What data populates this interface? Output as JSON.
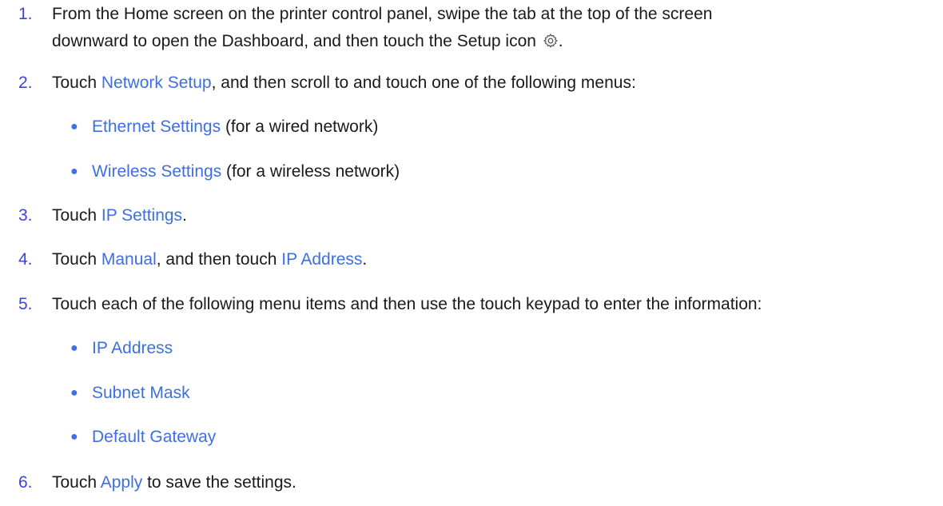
{
  "steps": [
    {
      "number": "1.",
      "line1": "From the Home screen on the printer control panel, swipe the tab at the top of the screen",
      "line2_pre": "downward to open the Dashboard, and then touch the Setup icon",
      "line2_post": ".",
      "icon": "gear-icon"
    },
    {
      "number": "2.",
      "pre": "Touch ",
      "link1": "Network Setup",
      "post": ", and then scroll to and touch one of the following menus:",
      "subitems": [
        {
          "link": "Ethernet Settings",
          "text": " (for a wired network)"
        },
        {
          "link": "Wireless Settings",
          "text": " (for a wireless network)"
        }
      ]
    },
    {
      "number": "3.",
      "pre": "Touch ",
      "link1": "IP Settings",
      "post": "."
    },
    {
      "number": "4.",
      "pre": "Touch ",
      "link1": "Manual",
      "mid": ", and then touch ",
      "link2": "IP Address",
      "post": "."
    },
    {
      "number": "5.",
      "text": "Touch each of the following menu items and then use the touch keypad to enter the information:",
      "subitems": [
        {
          "link": "IP Address"
        },
        {
          "link": "Subnet Mask"
        },
        {
          "link": "Default Gateway"
        }
      ]
    },
    {
      "number": "6.",
      "pre": "Touch ",
      "link1": "Apply",
      "post": " to save the settings."
    }
  ],
  "colors": {
    "text": "#1a1a1a",
    "number": "#3b44d6",
    "link": "#3d6fe0"
  }
}
